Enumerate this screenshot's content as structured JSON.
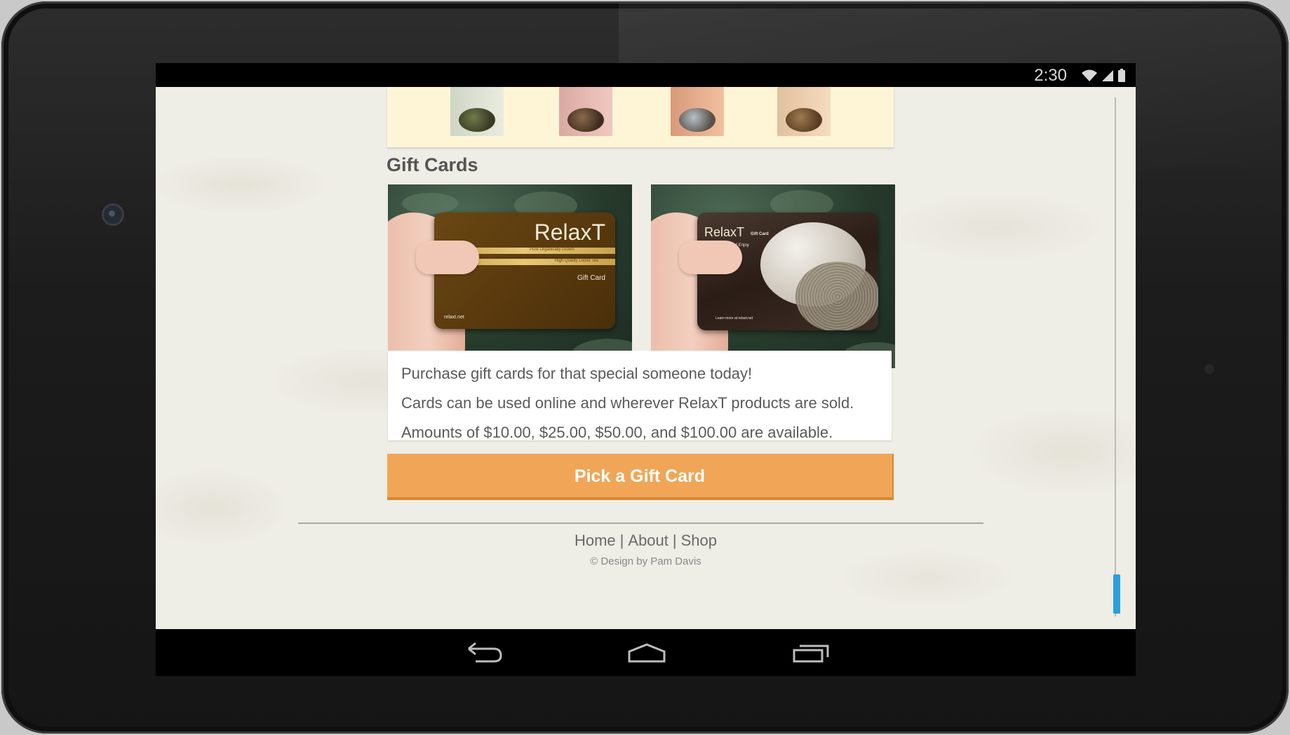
{
  "status_bar": {
    "time": "2:30"
  },
  "page": {
    "section_title": "Gift Cards",
    "gift_card_1": {
      "brand": "RelaxT",
      "line1": "Pure Organically Grown",
      "line2": "High Quality Loose Tea",
      "label": "Gift Card",
      "site": "relaxt.net"
    },
    "gift_card_2": {
      "brand": "RelaxT",
      "badge": "Gift Card",
      "tagline": "Relax and Enjoy",
      "footer": "Learn more at relaxt.net"
    },
    "info_lines": [
      "Purchase gift cards for that special someone today!",
      "Cards can be used online and wherever RelaxT products are sold.",
      "Amounts of $10.00, $25.00, $50.00, and $100.00 are available."
    ],
    "cta_label": "Pick a Gift Card"
  },
  "footer": {
    "nav": [
      "Home",
      "About",
      "Shop"
    ],
    "separator": "|",
    "credit": "© Design by Pam Davis"
  },
  "colors": {
    "cta": "#f0a656",
    "scroll_thumb": "#2aa0dc",
    "page_bg": "#eeede6"
  },
  "icons": {
    "status": [
      "wifi-icon",
      "signal-icon",
      "battery-icon"
    ],
    "nav": [
      "back-icon",
      "home-icon",
      "recent-apps-icon"
    ]
  }
}
